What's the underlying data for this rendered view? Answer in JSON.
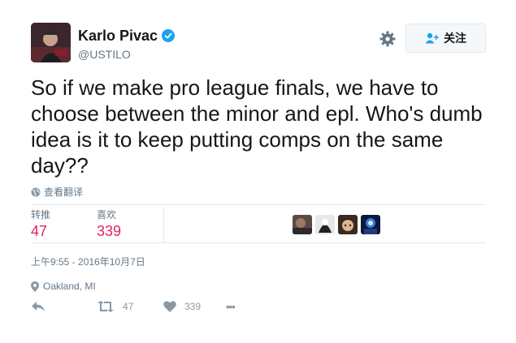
{
  "author": {
    "display_name": "Karlo Pivac",
    "handle": "@USTILO",
    "verified": true
  },
  "header": {
    "follow_label": "关注"
  },
  "tweet": {
    "text": "So if we make pro league finals, we have to choose between the minor and epl. Who's dumb idea is it to keep putting comps on the same day??",
    "translate_label": "查看翻译"
  },
  "stats": {
    "retweets_label": "转推",
    "retweets_value": "47",
    "likes_label": "喜欢",
    "likes_value": "339"
  },
  "meta": {
    "timestamp": "上午9:55 - 2016年10月7日",
    "location": "Oakland, MI"
  },
  "actions": {
    "retweet_count": "47",
    "like_count": "339",
    "more_label": "•••"
  },
  "colors": {
    "accent": "#e0245e",
    "verified": "#1da1f2",
    "muted": "#657786",
    "icon": "#8899a6"
  },
  "icons": [
    "gear-icon",
    "follow-user-icon",
    "globe-icon",
    "location-pin-icon",
    "reply-icon",
    "retweet-icon",
    "heart-icon",
    "more-icon",
    "verified-badge-icon"
  ]
}
